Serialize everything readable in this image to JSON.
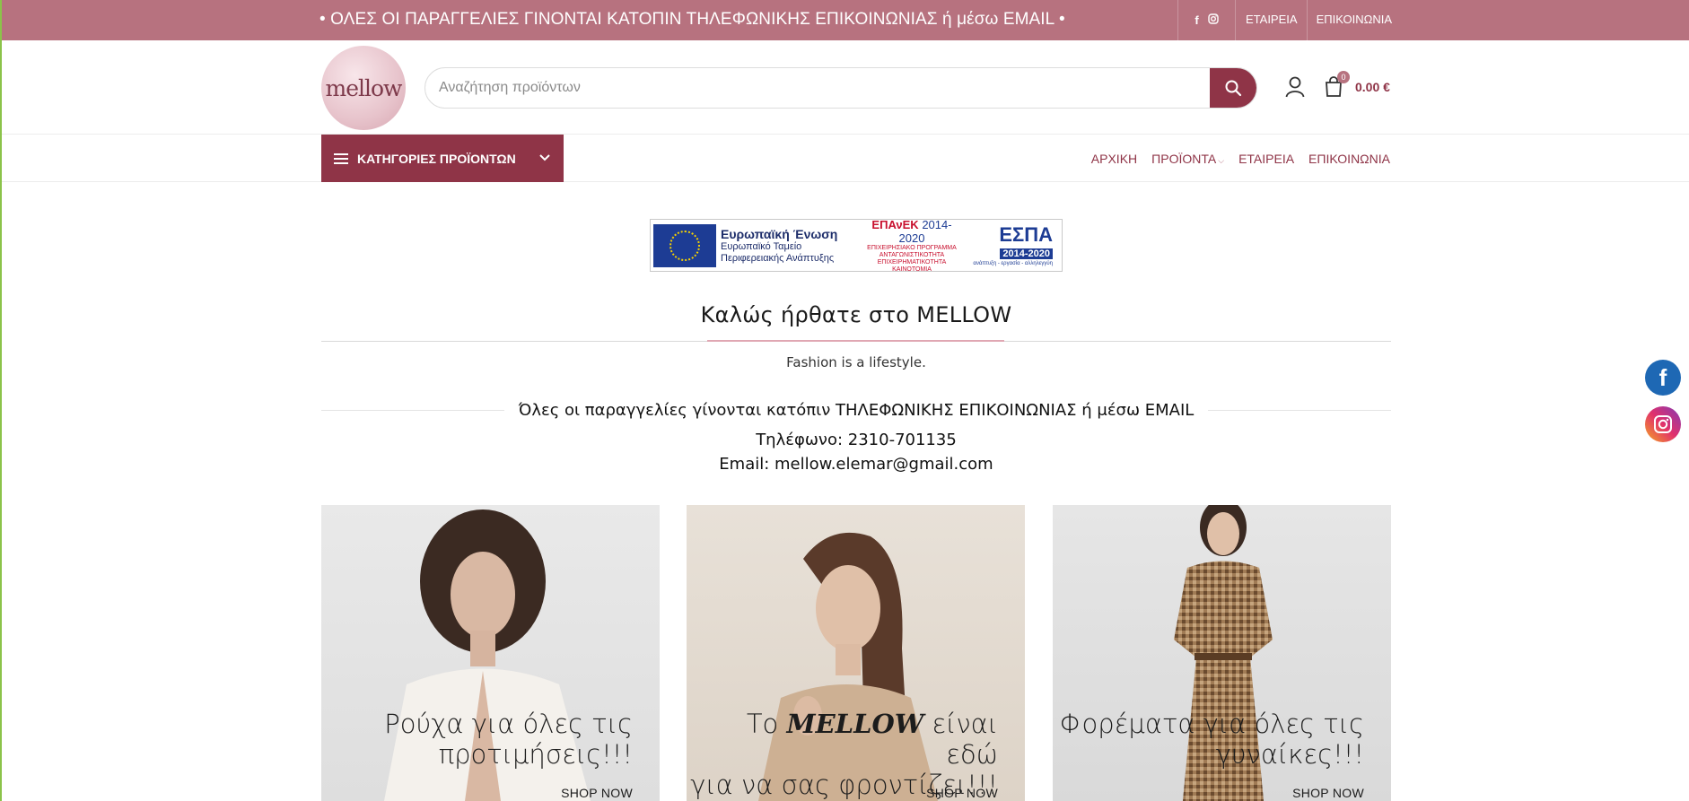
{
  "topbar": {
    "promo": "• ΟΛΕΣ ΟΙ ΠΑΡΑΓΓΕΛΙΕΣ ΓΙΝΟΝΤΑΙ ΚΑΤΟΠΙΝ ΤΗΛΕΦΩΝΙΚΗΣ ΕΠΙΚΟΙΝΩΝΙΑΣ ή μέσω EMAIL •",
    "social": [
      "facebook-icon",
      "instagram-icon"
    ],
    "links": [
      "ΕΤΑΙΡΕΙΑ",
      "ΕΠΙΚΟΙΝΩΝΙΑ"
    ]
  },
  "header": {
    "logo_text": "mellow",
    "search_placeholder": "Αναζήτηση προϊόντων",
    "cart_count": "0",
    "cart_total": "0.00 €"
  },
  "nav": {
    "categories_label": "ΚΑΤΗΓΟΡΙΕΣ ΠΡΟΪΟΝΤΩΝ",
    "items": [
      "ΑΡΧΙΚΗ",
      "ΠΡΟΪΟΝΤΑ",
      "ΕΤΑΙΡΕΙΑ",
      "ΕΠΙΚΟΙΝΩΝΙΑ"
    ]
  },
  "banner": {
    "eu_title": "Ευρωπαϊκή Ένωση",
    "eu_line1": "Ευρωπαϊκό Ταμείο",
    "eu_line2": "Περιφερειακής Ανάπτυξης",
    "epanek_name": "ΕΠΑνΕΚ",
    "epanek_years": "2014-2020",
    "epanek_line1": "ΕΠΙΧΕΙΡΗΣΙΑΚΟ ΠΡΟΓΡΑΜΜΑ",
    "epanek_line2": "ΑΝΤΑΓΩΝΙΣΤΙΚΟΤΗΤΑ",
    "epanek_line3": "ΕΠΙΧΕΙΡΗΜΑΤΙΚΟΤΗΤΑ",
    "epanek_line4": "ΚΑΙΝΟΤΟΜΙΑ",
    "espa_name": "ΕΣΠΑ",
    "espa_years": "2014-2020",
    "espa_slogan": "ανάπτυξη - εργασία - αλληλεγγύη"
  },
  "welcome": {
    "title": "Καλώς ήρθατε στο MELLOW",
    "tagline": "Fashion is a lifestyle.",
    "orders_note": "Όλες οι παραγγελίες γίνονται κατόπιν ΤΗΛΕΦΩΝΙΚΗΣ ΕΠΙΚΟΙΝΩΝΙΑΣ ή μέσω EMAIL",
    "phone": "Τηλέφωνο: 2310-701135",
    "email": "Email: mellow.elemar@gmail.com"
  },
  "cards": [
    {
      "line1": "Ρούχα για όλες τις",
      "line2": "προτιμήσεις!!!",
      "cta": "SHOP NOW"
    },
    {
      "line1_pre": "Το ",
      "line1_brand": "MELLOW",
      "line1_post": " είναι εδώ",
      "line2": "για να σας φροντίζει!!!",
      "cta": "SHOP NOW"
    },
    {
      "line1": "Φορέματα για όλες τις",
      "line2": "γυναίκες!!!",
      "cta": "SHOP NOW"
    }
  ],
  "colors": {
    "topbar": "#b7727f",
    "accent": "#8f3447",
    "facebook": "#1e68b4"
  }
}
